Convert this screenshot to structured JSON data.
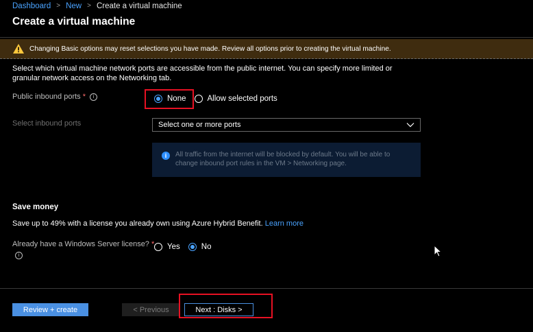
{
  "breadcrumb": {
    "items": [
      "Dashboard",
      "New"
    ],
    "current": "Create a virtual machine",
    "separator": ">"
  },
  "page_title": "Create a virtual machine",
  "banner": {
    "text": "Changing Basic options may reset selections you have made. Review all options prior to creating the virtual machine.",
    "icon": "warning-icon",
    "color": "#3f2c0f"
  },
  "intro_text": "Select which virtual machine network ports are accessible from the public internet. You can specify more limited or granular network access on the Networking tab.",
  "public_inbound_ports": {
    "label": "Public inbound ports",
    "required_marker": "*",
    "info_glyph": "i",
    "options": [
      "None",
      "Allow selected ports"
    ],
    "selected": "None"
  },
  "select_inbound_ports": {
    "label": "Select inbound ports",
    "placeholder": "Select one or more ports",
    "chevron_glyph": "⌵"
  },
  "info_message": {
    "icon_glyph": "i",
    "text": "All traffic from the internet will be blocked by default. You will be able to change inbound port rules in the VM > Networking page."
  },
  "save_money": {
    "title": "Save money",
    "text": "Save up to 49% with a license you already own using Azure Hybrid Benefit.",
    "link": "Learn more"
  },
  "windows_license": {
    "label": "Already have a Windows Server license?",
    "required_marker": "*",
    "info_glyph": "i",
    "options": [
      "Yes",
      "No"
    ],
    "selected": "No"
  },
  "footer": {
    "review_create": "Review + create",
    "previous": "< Previous",
    "next": "Next : Disks >"
  },
  "colors": {
    "accent": "#4a90e2",
    "link": "#4aa3ff",
    "highlight": "#e81123",
    "required": "#ff6b6b"
  }
}
